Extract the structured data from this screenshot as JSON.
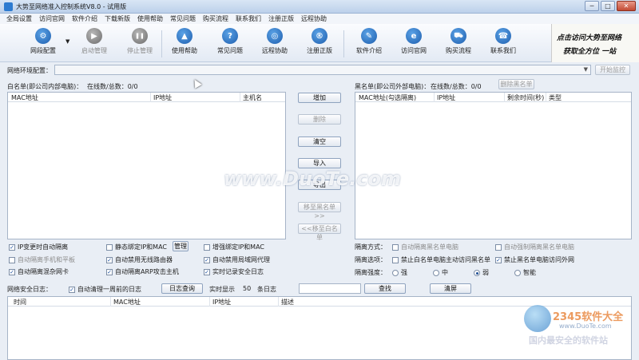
{
  "window": {
    "title": "大势至网络准入控制系统V8.0 - 试用版",
    "min": "─",
    "max": "□",
    "close": "✕"
  },
  "menu": [
    "全局设置",
    "访问官网",
    "软件介绍",
    "下载新版",
    "使用帮助",
    "常见问题",
    "购买流程",
    "联系我们",
    "注册正版",
    "远程协助"
  ],
  "toolbar": [
    {
      "label": "网段配置",
      "icon": "gear-icon",
      "glyph": "⚙",
      "enabled": true
    },
    {
      "label": "启动管理",
      "icon": "play-icon",
      "glyph": "▶",
      "enabled": false
    },
    {
      "label": "停止管理",
      "icon": "pause-icon",
      "glyph": "❚❚",
      "enabled": false
    },
    {
      "label": "使用帮助",
      "icon": "graduation-cap-icon",
      "glyph": "▲",
      "enabled": true
    },
    {
      "label": "常见问题",
      "icon": "question-icon",
      "glyph": "?",
      "enabled": true
    },
    {
      "label": "远程协助",
      "icon": "globe-icon",
      "glyph": "◎",
      "enabled": true
    },
    {
      "label": "注册正版",
      "icon": "registered-icon",
      "glyph": "®",
      "enabled": true
    },
    {
      "label": "软件介绍",
      "icon": "pen-icon",
      "glyph": "✎",
      "enabled": true
    },
    {
      "label": "访问官网",
      "icon": "ie-icon",
      "glyph": "e",
      "enabled": true
    },
    {
      "label": "购买流程",
      "icon": "cart-icon",
      "glyph": "🛒",
      "enabled": true
    },
    {
      "label": "联系我们",
      "icon": "headset-icon",
      "glyph": "☎",
      "enabled": true
    }
  ],
  "banner": {
    "line1": "点击访问大势至网络",
    "line2": "获取全方位 一站"
  },
  "env": {
    "label": "网络环境配置：",
    "value": "",
    "start_button": "开始监控"
  },
  "whitelist": {
    "label": "白名单(即公司内部电脑)：",
    "online": "在线数/总数：0/0",
    "columns": [
      "MAC地址",
      "IP地址",
      "主机名"
    ]
  },
  "blacklist": {
    "label": "黑名单(即公司外部电脑)：",
    "online": "在线数/总数：0/0",
    "delete_button": "删除黑名单",
    "columns": [
      "MAC地址(勾选隔离)",
      "IP地址",
      "剩余时间(秒)",
      "类型"
    ]
  },
  "center_buttons": [
    {
      "label": "增加",
      "enabled": true
    },
    {
      "label": "删除",
      "enabled": false
    },
    {
      "label": "清空",
      "enabled": true
    },
    {
      "label": "导入",
      "enabled": true
    },
    {
      "label": "导出",
      "enabled": true
    },
    {
      "label": "移至黑名单>>",
      "enabled": false
    },
    {
      "label": "<<移至白名单",
      "enabled": false
    }
  ],
  "options_left": [
    {
      "label": "IP变更时自动隔离",
      "checked": true,
      "enabled": true
    },
    {
      "label": "静态绑定IP和MAC",
      "checked": false,
      "enabled": true
    },
    {
      "label": "增强绑定IP和MAC",
      "checked": false,
      "enabled": true
    },
    {
      "label": "自动隔离手机和平板",
      "checked": false,
      "enabled": false
    },
    {
      "label": "自动禁用无线路由器",
      "checked": true,
      "enabled": true
    },
    {
      "label": "自动禁用局域网代理",
      "checked": true,
      "enabled": true
    },
    {
      "label": "自动隔离混杂网卡",
      "checked": true,
      "enabled": true
    },
    {
      "label": "自动隔离ARP攻击主机",
      "checked": true,
      "enabled": true
    },
    {
      "label": "实时记录安全日志",
      "checked": true,
      "enabled": true
    }
  ],
  "manage_button": "管理",
  "isolation": {
    "method_label": "隔离方式：",
    "method_opts": [
      {
        "label": "自动隔离黑名单电脑",
        "checked": false,
        "enabled": false
      },
      {
        "label": "自动强制隔离黑名单电脑",
        "checked": false,
        "enabled": false
      }
    ],
    "option_label": "隔离选项：",
    "option_opts": [
      {
        "label": "禁止白名单电脑主动访问黑名单",
        "checked": false,
        "enabled": true
      },
      {
        "label": "禁止黑名单电脑访问外网",
        "checked": true,
        "enabled": true
      }
    ],
    "strength_label": "隔离强度：",
    "strength_opts": [
      {
        "label": "强",
        "selected": false
      },
      {
        "label": "中",
        "selected": false
      },
      {
        "label": "弱",
        "selected": true
      },
      {
        "label": "智能",
        "selected": false
      }
    ]
  },
  "log": {
    "label": "网络安全日志：",
    "auto_clean": "自动清理一周前的日志",
    "auto_clean_checked": true,
    "query_button": "日志查询",
    "realtime_label": "实时显示",
    "realtime_count": "50",
    "realtime_unit": "条日志",
    "search_value": "",
    "find_button": "查找",
    "clear_button": "清屏",
    "columns": [
      "时间",
      "MAC地址",
      "IP地址",
      "描述"
    ]
  },
  "watermarks": {
    "duote": "www.DuoTe.com",
    "site_name": "2345软件大全",
    "site_url": "www.DuoTe.com",
    "tagline": "国内最安全的软件站"
  }
}
